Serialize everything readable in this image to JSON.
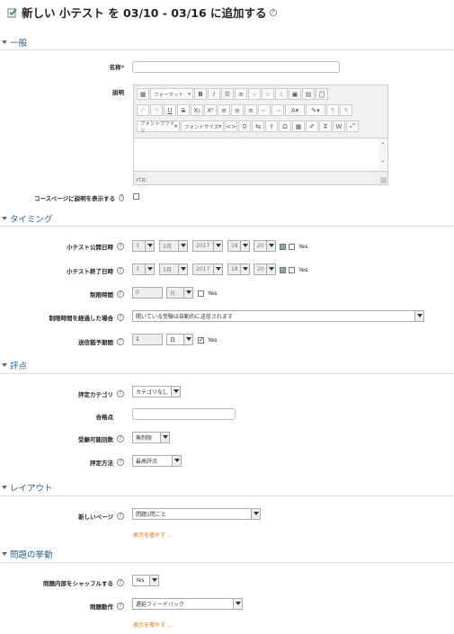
{
  "page_title": "新しい 小テスト を 03/10 - 03/16 に追加する",
  "sections": {
    "general": "一般",
    "timing": "タイミング",
    "grade": "評点",
    "layout": "レイアウト",
    "behaviour": "問題の挙動"
  },
  "general": {
    "name_label": "名称",
    "name_value": "",
    "desc_label": "説明",
    "show_desc_label": "コースページに説明を表示する",
    "show_desc_checked": false
  },
  "editor": {
    "format_select": "フォーマット",
    "font_family_select": "フォントファミリ",
    "font_size_select": "フォントサイズ",
    "status_path": "パス:",
    "toolbar_row1": [
      "table-icon",
      "bold-icon",
      "italic-icon",
      "bullet-list-icon",
      "number-list-icon",
      "link-icon",
      "unlink-icon",
      "anchor-icon",
      "image-icon",
      "media-icon",
      "paste-icon"
    ],
    "toolbar_row2": [
      "undo-icon",
      "redo-icon",
      "underline-icon",
      "strike-icon",
      "subscript-icon",
      "superscript-icon",
      "align-left-icon",
      "align-center-icon",
      "align-right-icon",
      "outdent-icon",
      "indent-icon",
      "text-color-icon",
      "bg-color-icon",
      "ltr-icon",
      "rtl-icon"
    ],
    "toolbar_row3": [
      "code-icon",
      "search-icon",
      "replace-icon",
      "upload-icon",
      "char-map-icon",
      "spell-icon",
      "clear-format-icon",
      "paste-text-icon",
      "paste-word-icon",
      "fullscreen-icon"
    ]
  },
  "timing": {
    "open_label": "小テスト公開日時",
    "open": {
      "day": "3",
      "month": "3月",
      "year": "2017",
      "hour": "18",
      "minute": "20",
      "enabled_label": "Yes"
    },
    "close_label": "小テスト終了日時",
    "close": {
      "day": "3",
      "month": "3月",
      "year": "2017",
      "hour": "18",
      "minute": "20",
      "enabled_label": "Yes"
    },
    "limit_label": "制限時間",
    "limit_value": "0",
    "limit_unit": "分",
    "limit_enabled_label": "Yes",
    "overdue_label": "制限時間を経過した場合",
    "overdue_value": "開いている受験は自動的に送信されます",
    "grace_label": "送信猶予期間",
    "grace_value": "1",
    "grace_unit": "日",
    "grace_enabled_label": "Yes",
    "grace_enabled_checked": true
  },
  "grade": {
    "category_label": "評定カテゴリ",
    "category_value": "カテゴリなし",
    "pass_label": "合格点",
    "pass_value": "",
    "attempts_label": "受験可能回数",
    "attempts_value": "無制限",
    "method_label": "評定方法",
    "method_value": "最高評点"
  },
  "layout": {
    "newpage_label": "新しいページ",
    "newpage_value": "問題1問ごと",
    "show_more": "表示を増やす ..."
  },
  "behaviour": {
    "shuffle_label": "問題内部をシャッフルする",
    "shuffle_value": "Yes",
    "mode_label": "問題動作",
    "mode_value": "遅延フィードバック",
    "show_more": "表示を増やす ..."
  }
}
